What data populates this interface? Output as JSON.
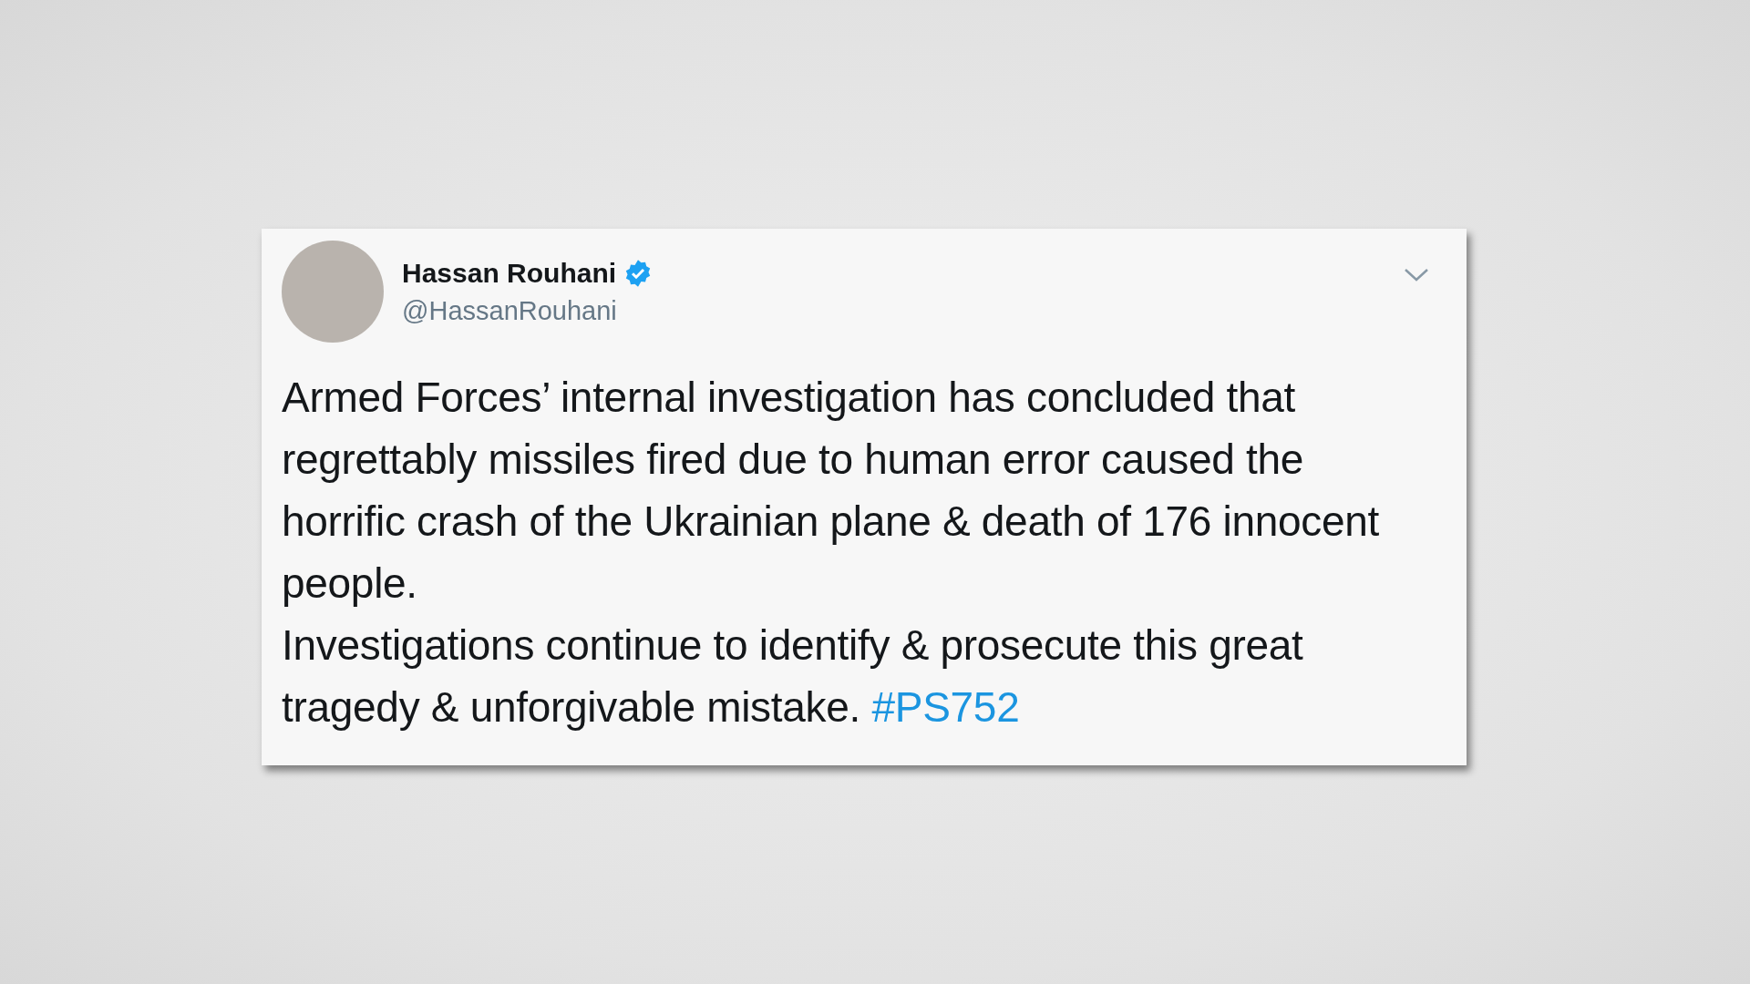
{
  "tweet": {
    "name": "Hassan Rouhani",
    "verified": true,
    "handle": "@HassanRouhani",
    "paragraphs": [
      {
        "text": "Armed Forces’ internal investigation has concluded that regrettably missiles fired due to human error caused the horrific crash of the Ukrainian plane & death of 176 innocent people."
      },
      {
        "text": "Investigations continue to identify & prosecute this great tragedy & unforgivable mistake.",
        "hashtag": "#PS752"
      }
    ]
  }
}
